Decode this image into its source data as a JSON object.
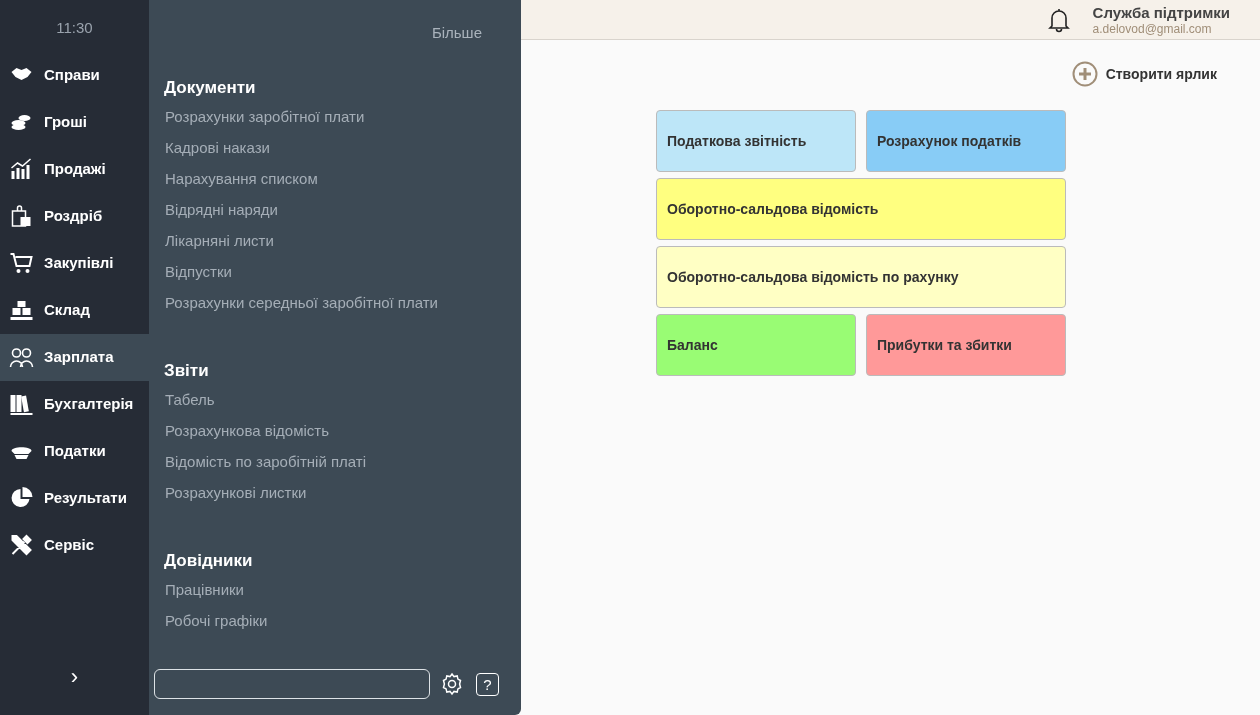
{
  "clock": "11:30",
  "nav": [
    {
      "label": "Справи",
      "selected": false
    },
    {
      "label": "Гроші",
      "selected": false
    },
    {
      "label": "Продажі",
      "selected": false
    },
    {
      "label": "Роздріб",
      "selected": false
    },
    {
      "label": "Закупівлі",
      "selected": false
    },
    {
      "label": "Склад",
      "selected": false
    },
    {
      "label": "Зарплата",
      "selected": true
    },
    {
      "label": "Бухгалтерія",
      "selected": false
    },
    {
      "label": "Податки",
      "selected": false
    },
    {
      "label": "Результати",
      "selected": false
    },
    {
      "label": "Сервіс",
      "selected": false
    }
  ],
  "expand": "›",
  "flyout": {
    "more": "Більше",
    "sections": [
      {
        "title": "Документи",
        "items": [
          "Розрахунки заробітної плати",
          "Кадрові накази",
          "Нарахування списком",
          "Відрядні наряди",
          "Лікарняні листи",
          "Відпустки",
          "Розрахунки середньої заробітної плати"
        ]
      },
      {
        "title": "Звіти",
        "items": [
          "Табель",
          "Розрахункова відомість",
          "Відомість по заробітній платі",
          "Розрахункові листки"
        ]
      },
      {
        "title": "Довідники",
        "items": [
          "Працівники",
          "Робочі графіки"
        ]
      }
    ],
    "help": "?"
  },
  "user": {
    "name": "Служба підтримки",
    "email": "a.delovod@gmail.com"
  },
  "create_shortcut": "Створити ярлик",
  "tiles": [
    {
      "label": "Податкова звітність",
      "color": "#bde6f8",
      "wide": false
    },
    {
      "label": "Розрахунок податків",
      "color": "#88ccf6",
      "wide": false
    },
    {
      "label": "Оборотно-сальдова відомість",
      "color": "#ffff80",
      "wide": true
    },
    {
      "label": "Оборотно-сальдова відомість по рахунку",
      "color": "#ffffc4",
      "wide": true
    },
    {
      "label": "Баланс",
      "color": "#99fc74",
      "wide": false
    },
    {
      "label": "Прибутки та збитки",
      "color": "#ff9999",
      "wide": false
    }
  ]
}
